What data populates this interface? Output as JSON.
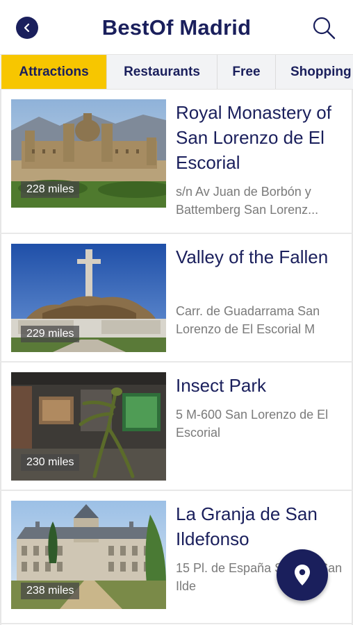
{
  "header": {
    "title": "BestOf Madrid"
  },
  "tabs": [
    {
      "label": "Attractions",
      "active": true
    },
    {
      "label": "Restaurants",
      "active": false
    },
    {
      "label": "Free",
      "active": false
    },
    {
      "label": "Shopping",
      "active": false
    }
  ],
  "items": [
    {
      "name": "Royal Monastery of San Lorenzo de El Escorial",
      "address": "s/n Av Juan de Borbón y Battemberg San Lorenz...",
      "distance": "228 miles"
    },
    {
      "name": "Valley of the Fallen",
      "address": "Carr. de Guadarrama San Lorenzo de El Escorial M",
      "distance": "229 miles"
    },
    {
      "name": "Insect Park",
      "address": "5 M-600 San Lorenzo de El Escorial",
      "distance": "230 miles"
    },
    {
      "name": "La Granja de San Ildefonso",
      "address": "15 Pl. de España Sitio de San Ilde",
      "distance": "238 miles"
    }
  ],
  "colors": {
    "brand_navy": "#1a1f5c",
    "active_tab": "#f7c600"
  },
  "icons": {
    "back": "chevron-left-icon",
    "search": "search-icon",
    "map": "location-pin-icon"
  }
}
